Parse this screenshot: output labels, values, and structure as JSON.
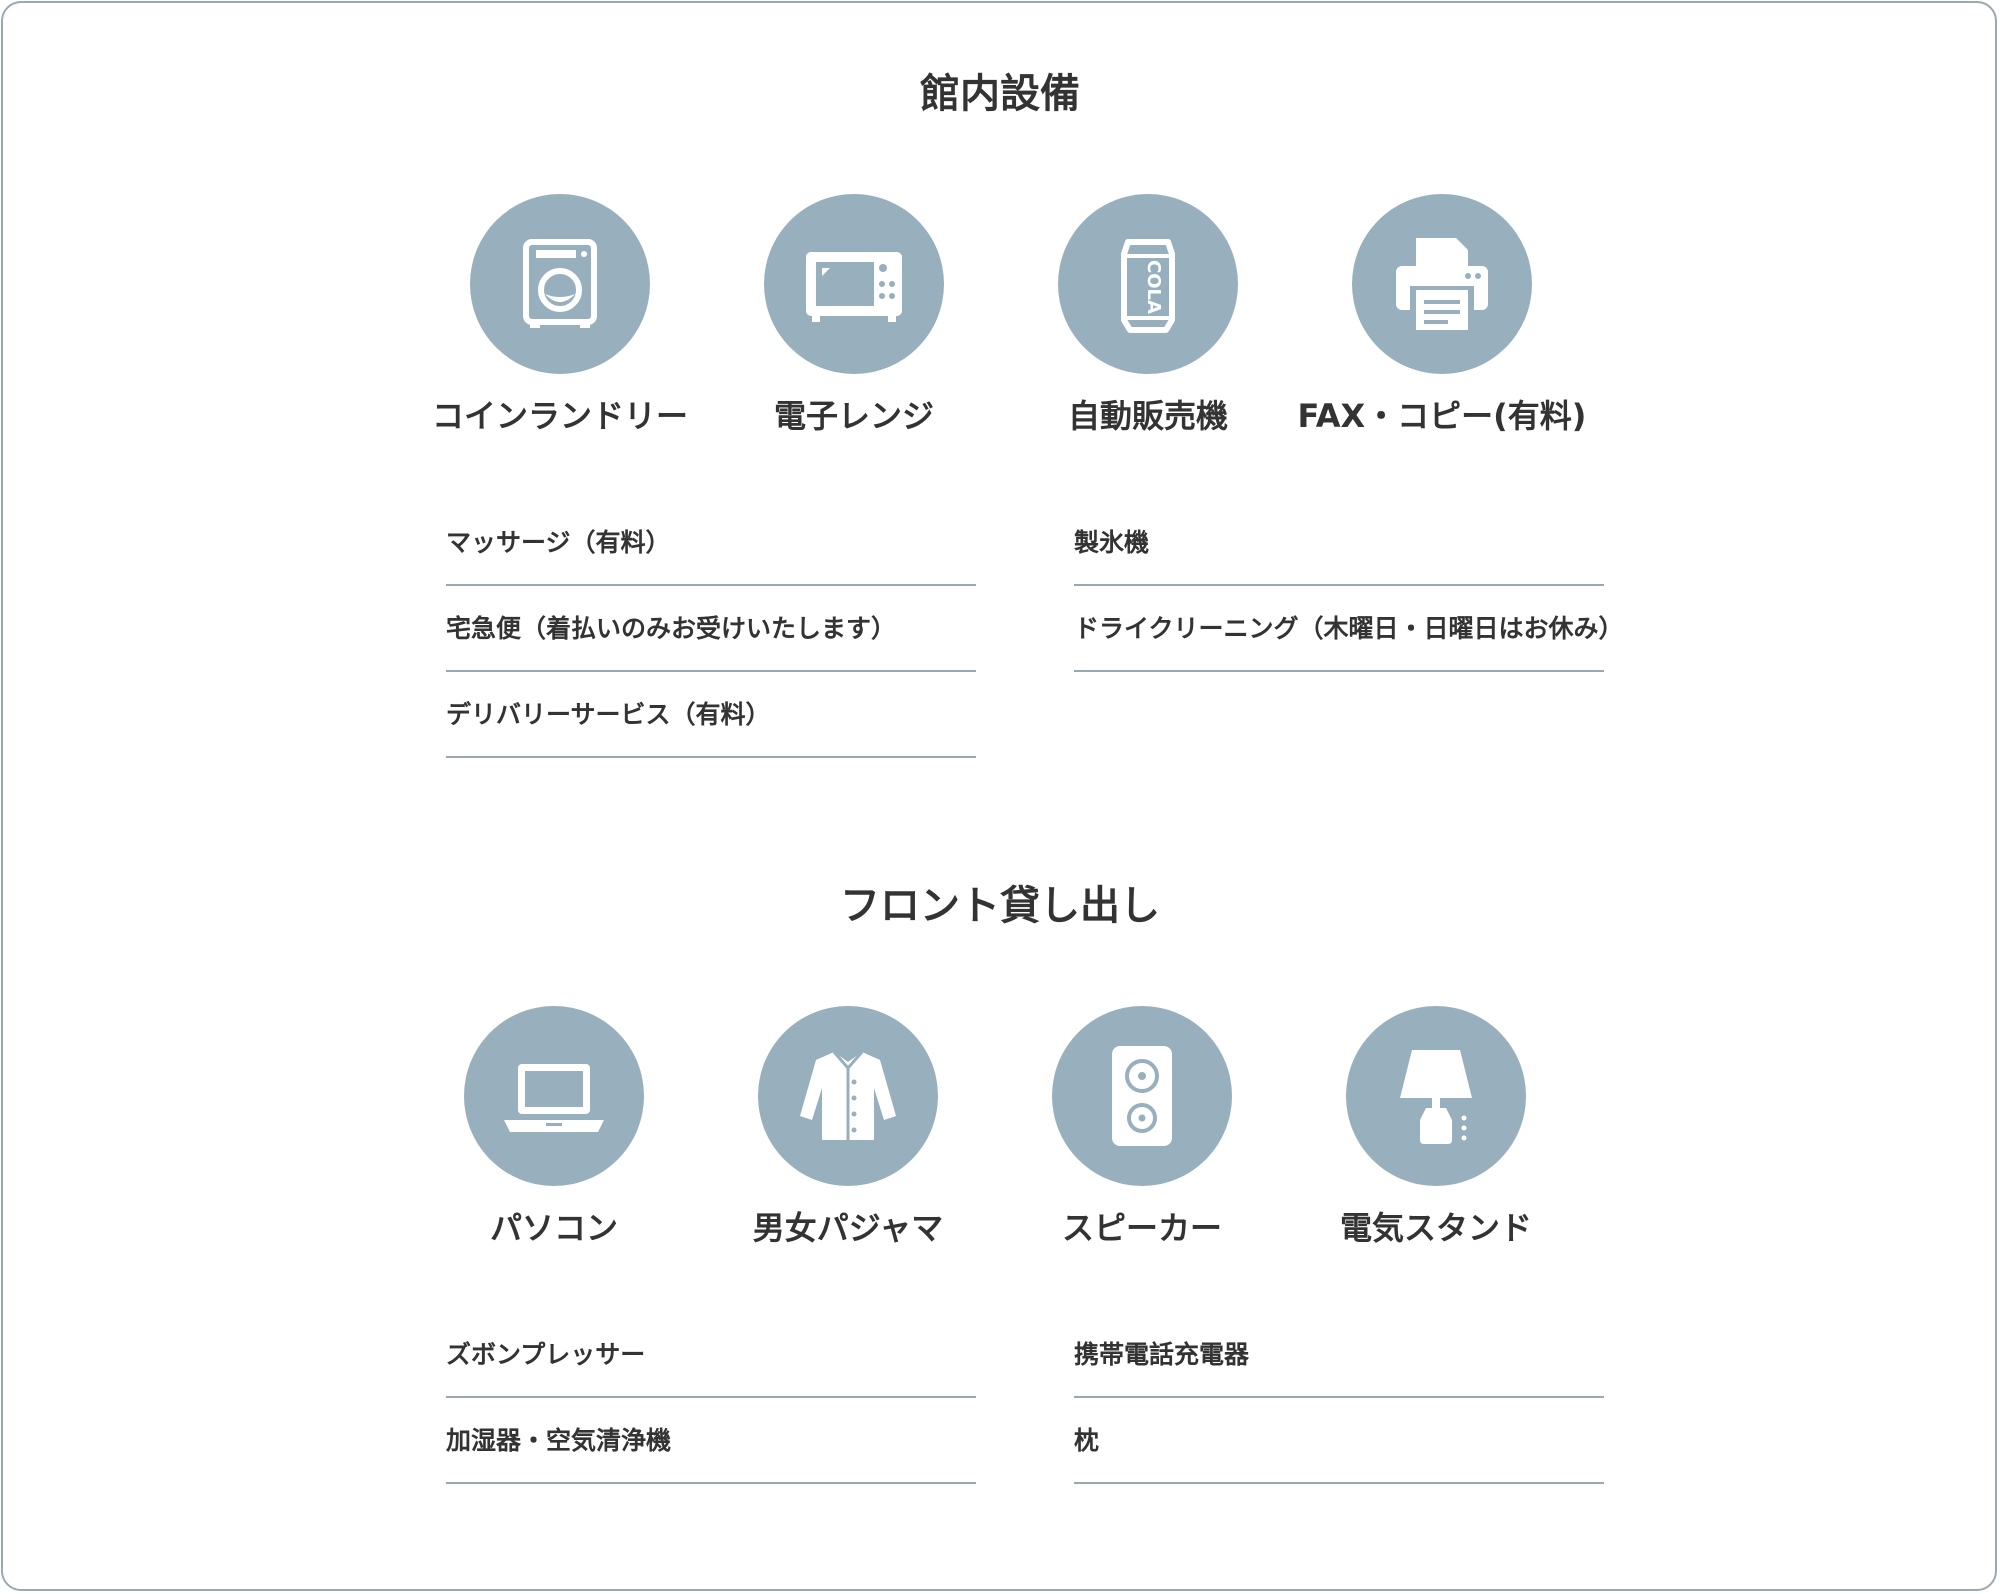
{
  "sections": [
    {
      "title": "館内設備",
      "items": [
        {
          "label": "コインランドリー",
          "icon": "washing-machine-icon"
        },
        {
          "label": "電子レンジ",
          "icon": "microwave-icon"
        },
        {
          "label": "自動販売機",
          "icon": "cola-can-icon"
        },
        {
          "label": "FAX・コピー(有料)",
          "icon": "printer-icon"
        }
      ],
      "list_left": [
        "マッサージ（有料）",
        "宅急便（着払いのみお受けいたします）",
        "デリバリーサービス（有料）"
      ],
      "list_right": [
        "製氷機",
        "ドライクリーニング（木曜日・日曜日はお休み）"
      ]
    },
    {
      "title": "フロント貸し出し",
      "items": [
        {
          "label": "パソコン",
          "icon": "laptop-icon"
        },
        {
          "label": "男女パジャマ",
          "icon": "pajama-shirt-icon"
        },
        {
          "label": "スピーカー",
          "icon": "speaker-icon"
        },
        {
          "label": "電気スタンド",
          "icon": "desk-lamp-icon"
        }
      ],
      "list_left": [
        "ズボンプレッサー",
        "加湿器・空気清浄機"
      ],
      "list_right": [
        "携帯電話充電器",
        "枕"
      ]
    }
  ],
  "colors": {
    "circle": "#98afbd",
    "line": "#9aa8b0",
    "text": "#333333",
    "icon": "#ffffff"
  }
}
